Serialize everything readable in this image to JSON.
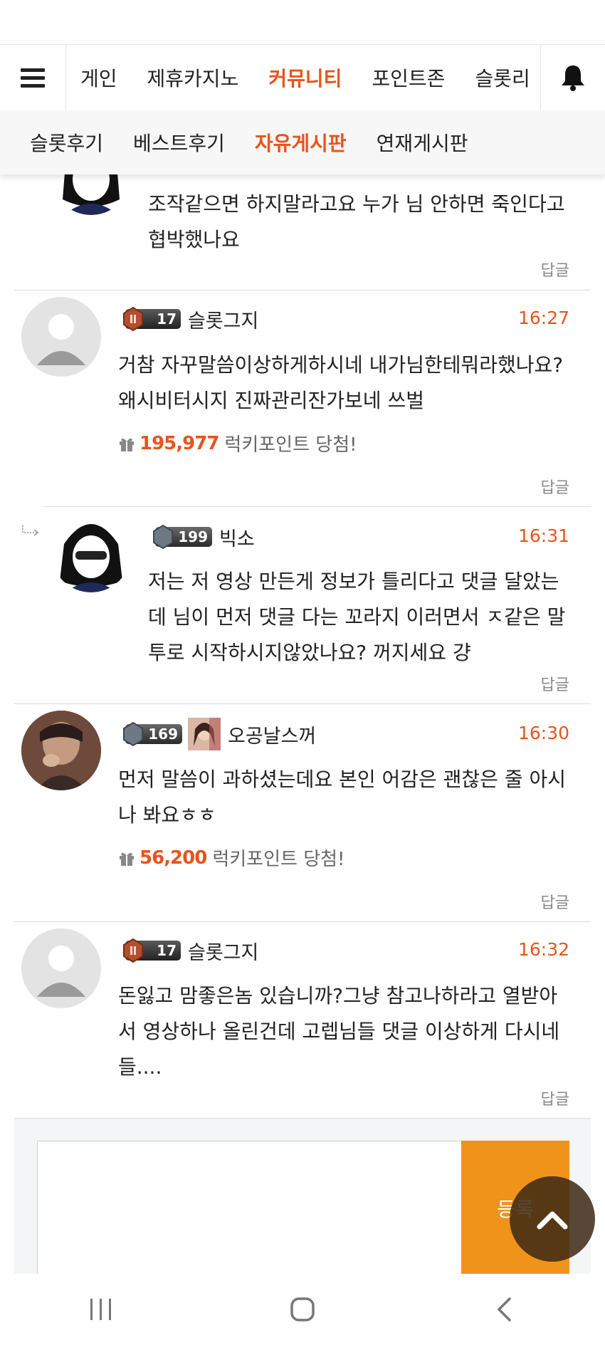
{
  "nav": {
    "items": [
      "게인",
      "제휴카지노",
      "커뮤니티",
      "포인트존",
      "슬롯리"
    ],
    "active_index": 2
  },
  "subnav": {
    "items": [
      "슬롯후기",
      "베스트후기",
      "자유게시판",
      "연재게시판"
    ],
    "active_index": 2
  },
  "top_partial_comment": {
    "text": "조작같으면 하지말라고요 누가 님 안하면 죽인다고 협박했나요",
    "reply_label": "답글"
  },
  "comments": [
    {
      "level": "17",
      "nickname": "슬롯그지",
      "time": "16:27",
      "text": "거참 자꾸말씀이상하게하시네 내가님한테뭐라했나요?왜시비터시지 진짜관리잔가보네 쓰벌",
      "point_amount": "195,977",
      "point_label": "럭키포인트 당첨!",
      "reply_label": "답글"
    },
    {
      "level": "199",
      "nickname": "빅소",
      "time": "16:31",
      "text": "저는 저 영상 만든게 정보가 틀리다고 댓글 달았는데 님이 먼저 댓글 다는 꼬라지 이러면서 ㅈ같은 말투로 시작하시지않았나요? 꺼지세요 걍",
      "reply_label": "답글"
    },
    {
      "level": "169",
      "nickname": "오공날스꺼",
      "time": "16:30",
      "text": "먼저 말씀이 과하셨는데요 본인 어감은 괜찮은 줄 아시나 봐요ㅎㅎ",
      "point_amount": "56,200",
      "point_label": "럭키포인트 당첨!",
      "reply_label": "답글"
    },
    {
      "level": "17",
      "nickname": "슬롯그지",
      "time": "16:32",
      "text": "돈잃고 맘좋은놈 있습니까?그냥 참고나하라고 열받아서 영상하나 올린건데 고렙님들 댓글 이상하게 다시네들....",
      "reply_label": "답글"
    }
  ],
  "write": {
    "submit_label": "등록"
  },
  "colors": {
    "accent": "#e8541c",
    "submit": "#f0931b"
  },
  "icons": [
    "menu-icon",
    "bell-icon",
    "gift-icon",
    "reply-arrow-icon",
    "chevron-up-icon",
    "recent-apps-icon",
    "home-icon",
    "back-icon"
  ]
}
